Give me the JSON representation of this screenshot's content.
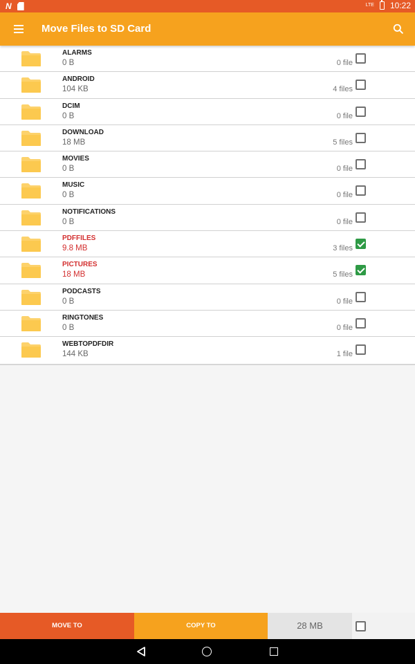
{
  "status_bar": {
    "time": "10:22",
    "network": "LTE"
  },
  "app_bar": {
    "title": "Move Files to SD Card",
    "menu_icon": "hamburger-menu-icon",
    "search_icon": "search-icon"
  },
  "colors": {
    "status_bar": "#e65a26",
    "app_bar": "#f6a21e",
    "selected_text": "#d32f2f",
    "checkbox_checked": "#2e9a45",
    "folder": "#fdd26b"
  },
  "folders": [
    {
      "name": "ALARMS",
      "size": "0 B",
      "count": "0 file",
      "checked": false
    },
    {
      "name": "ANDROID",
      "size": "104 KB",
      "count": "4 files",
      "checked": false
    },
    {
      "name": "DCIM",
      "size": "0 B",
      "count": "0 file",
      "checked": false
    },
    {
      "name": "DOWNLOAD",
      "size": "18 MB",
      "count": "5 files",
      "checked": false
    },
    {
      "name": "MOVIES",
      "size": "0 B",
      "count": "0 file",
      "checked": false
    },
    {
      "name": "MUSIC",
      "size": "0 B",
      "count": "0 file",
      "checked": false
    },
    {
      "name": "NOTIFICATIONS",
      "size": "0 B",
      "count": "0 file",
      "checked": false
    },
    {
      "name": "PDFFILES",
      "size": "9.8 MB",
      "count": "3 files",
      "checked": true
    },
    {
      "name": "PICTURES",
      "size": "18 MB",
      "count": "5 files",
      "checked": true
    },
    {
      "name": "PODCASTS",
      "size": "0 B",
      "count": "0 file",
      "checked": false
    },
    {
      "name": "RINGTONES",
      "size": "0 B",
      "count": "0 file",
      "checked": false
    },
    {
      "name": "WEBTOPDFDIR",
      "size": "144 KB",
      "count": "1 file",
      "checked": false
    }
  ],
  "bottom_bar": {
    "move_label": "MOVE TO",
    "copy_label": "COPY TO",
    "total_size": "28 MB",
    "select_all_checked": false
  }
}
